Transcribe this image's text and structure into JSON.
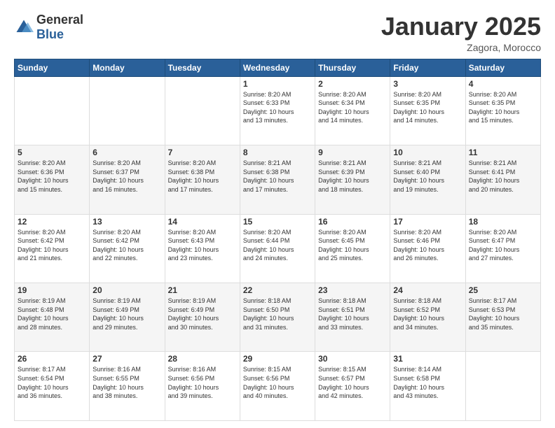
{
  "logo": {
    "general": "General",
    "blue": "Blue"
  },
  "title": {
    "month": "January 2025",
    "location": "Zagora, Morocco"
  },
  "weekdays": [
    "Sunday",
    "Monday",
    "Tuesday",
    "Wednesday",
    "Thursday",
    "Friday",
    "Saturday"
  ],
  "weeks": [
    [
      {
        "day": "",
        "info": ""
      },
      {
        "day": "",
        "info": ""
      },
      {
        "day": "",
        "info": ""
      },
      {
        "day": "1",
        "info": "Sunrise: 8:20 AM\nSunset: 6:33 PM\nDaylight: 10 hours\nand 13 minutes."
      },
      {
        "day": "2",
        "info": "Sunrise: 8:20 AM\nSunset: 6:34 PM\nDaylight: 10 hours\nand 14 minutes."
      },
      {
        "day": "3",
        "info": "Sunrise: 8:20 AM\nSunset: 6:35 PM\nDaylight: 10 hours\nand 14 minutes."
      },
      {
        "day": "4",
        "info": "Sunrise: 8:20 AM\nSunset: 6:35 PM\nDaylight: 10 hours\nand 15 minutes."
      }
    ],
    [
      {
        "day": "5",
        "info": "Sunrise: 8:20 AM\nSunset: 6:36 PM\nDaylight: 10 hours\nand 15 minutes."
      },
      {
        "day": "6",
        "info": "Sunrise: 8:20 AM\nSunset: 6:37 PM\nDaylight: 10 hours\nand 16 minutes."
      },
      {
        "day": "7",
        "info": "Sunrise: 8:20 AM\nSunset: 6:38 PM\nDaylight: 10 hours\nand 17 minutes."
      },
      {
        "day": "8",
        "info": "Sunrise: 8:21 AM\nSunset: 6:38 PM\nDaylight: 10 hours\nand 17 minutes."
      },
      {
        "day": "9",
        "info": "Sunrise: 8:21 AM\nSunset: 6:39 PM\nDaylight: 10 hours\nand 18 minutes."
      },
      {
        "day": "10",
        "info": "Sunrise: 8:21 AM\nSunset: 6:40 PM\nDaylight: 10 hours\nand 19 minutes."
      },
      {
        "day": "11",
        "info": "Sunrise: 8:21 AM\nSunset: 6:41 PM\nDaylight: 10 hours\nand 20 minutes."
      }
    ],
    [
      {
        "day": "12",
        "info": "Sunrise: 8:20 AM\nSunset: 6:42 PM\nDaylight: 10 hours\nand 21 minutes."
      },
      {
        "day": "13",
        "info": "Sunrise: 8:20 AM\nSunset: 6:42 PM\nDaylight: 10 hours\nand 22 minutes."
      },
      {
        "day": "14",
        "info": "Sunrise: 8:20 AM\nSunset: 6:43 PM\nDaylight: 10 hours\nand 23 minutes."
      },
      {
        "day": "15",
        "info": "Sunrise: 8:20 AM\nSunset: 6:44 PM\nDaylight: 10 hours\nand 24 minutes."
      },
      {
        "day": "16",
        "info": "Sunrise: 8:20 AM\nSunset: 6:45 PM\nDaylight: 10 hours\nand 25 minutes."
      },
      {
        "day": "17",
        "info": "Sunrise: 8:20 AM\nSunset: 6:46 PM\nDaylight: 10 hours\nand 26 minutes."
      },
      {
        "day": "18",
        "info": "Sunrise: 8:20 AM\nSunset: 6:47 PM\nDaylight: 10 hours\nand 27 minutes."
      }
    ],
    [
      {
        "day": "19",
        "info": "Sunrise: 8:19 AM\nSunset: 6:48 PM\nDaylight: 10 hours\nand 28 minutes."
      },
      {
        "day": "20",
        "info": "Sunrise: 8:19 AM\nSunset: 6:49 PM\nDaylight: 10 hours\nand 29 minutes."
      },
      {
        "day": "21",
        "info": "Sunrise: 8:19 AM\nSunset: 6:49 PM\nDaylight: 10 hours\nand 30 minutes."
      },
      {
        "day": "22",
        "info": "Sunrise: 8:18 AM\nSunset: 6:50 PM\nDaylight: 10 hours\nand 31 minutes."
      },
      {
        "day": "23",
        "info": "Sunrise: 8:18 AM\nSunset: 6:51 PM\nDaylight: 10 hours\nand 33 minutes."
      },
      {
        "day": "24",
        "info": "Sunrise: 8:18 AM\nSunset: 6:52 PM\nDaylight: 10 hours\nand 34 minutes."
      },
      {
        "day": "25",
        "info": "Sunrise: 8:17 AM\nSunset: 6:53 PM\nDaylight: 10 hours\nand 35 minutes."
      }
    ],
    [
      {
        "day": "26",
        "info": "Sunrise: 8:17 AM\nSunset: 6:54 PM\nDaylight: 10 hours\nand 36 minutes."
      },
      {
        "day": "27",
        "info": "Sunrise: 8:16 AM\nSunset: 6:55 PM\nDaylight: 10 hours\nand 38 minutes."
      },
      {
        "day": "28",
        "info": "Sunrise: 8:16 AM\nSunset: 6:56 PM\nDaylight: 10 hours\nand 39 minutes."
      },
      {
        "day": "29",
        "info": "Sunrise: 8:15 AM\nSunset: 6:56 PM\nDaylight: 10 hours\nand 40 minutes."
      },
      {
        "day": "30",
        "info": "Sunrise: 8:15 AM\nSunset: 6:57 PM\nDaylight: 10 hours\nand 42 minutes."
      },
      {
        "day": "31",
        "info": "Sunrise: 8:14 AM\nSunset: 6:58 PM\nDaylight: 10 hours\nand 43 minutes."
      },
      {
        "day": "",
        "info": ""
      }
    ]
  ]
}
